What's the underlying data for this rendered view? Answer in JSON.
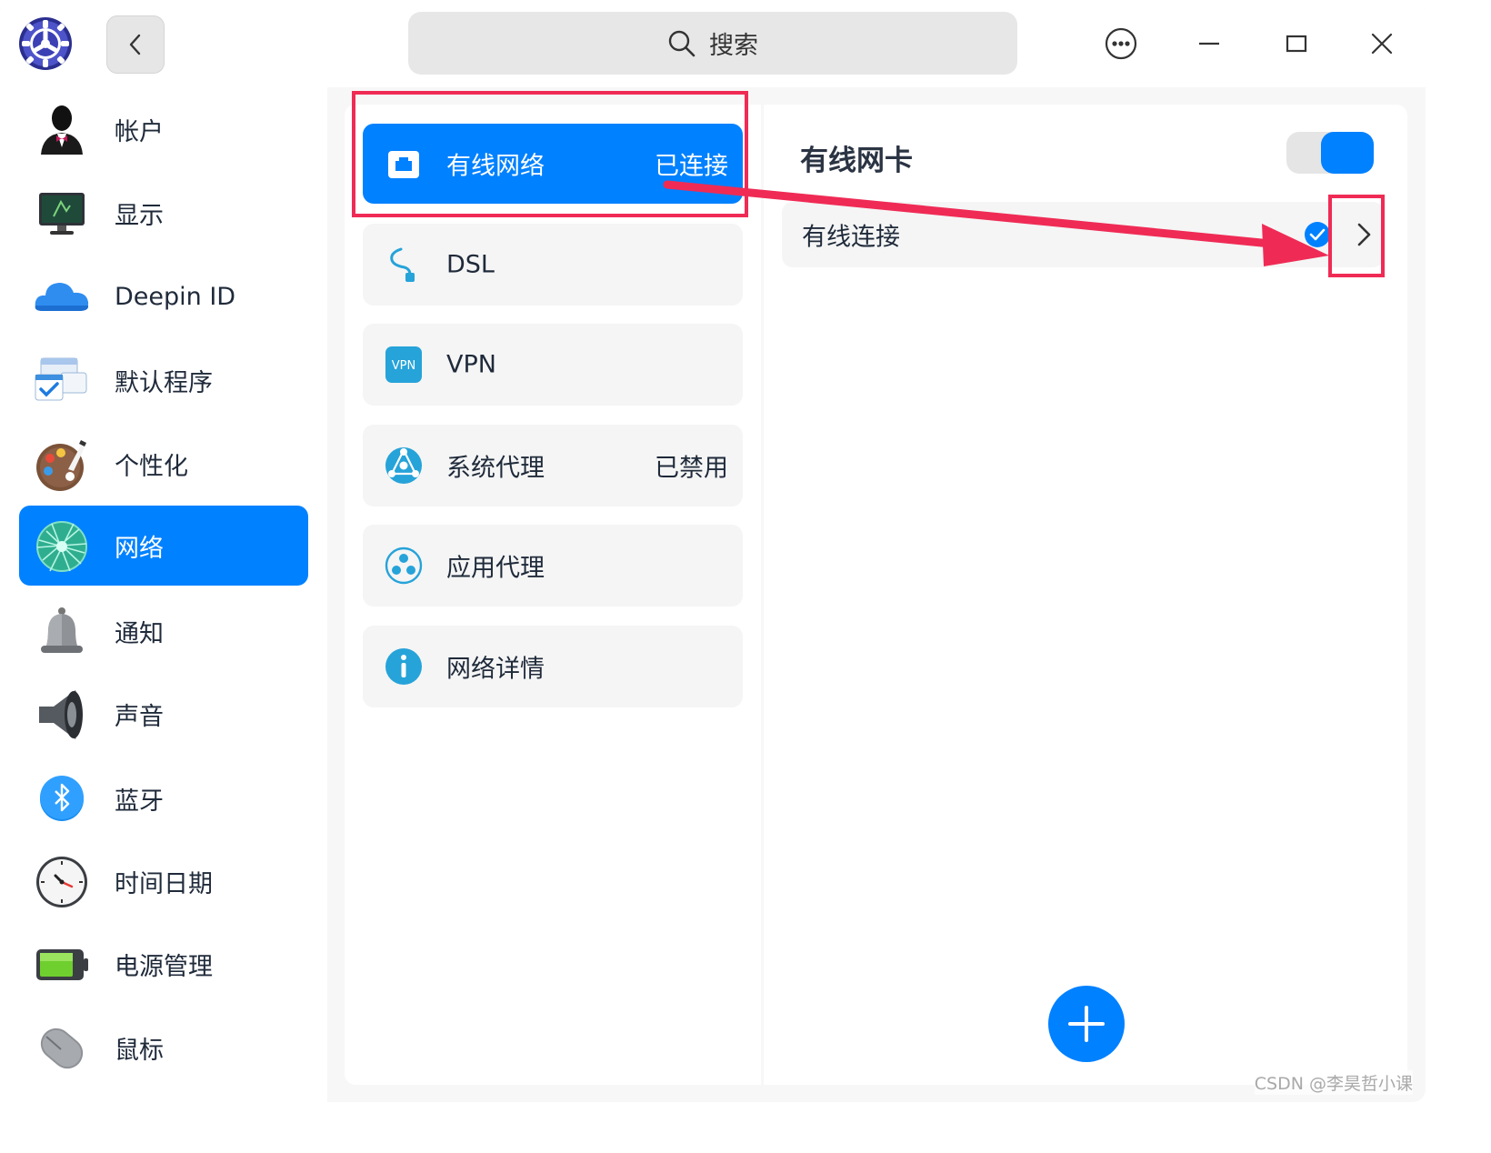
{
  "window": {
    "search_placeholder": "搜索"
  },
  "sidebar": {
    "items": [
      {
        "label": "帐户",
        "icon": "user-account-icon"
      },
      {
        "label": "显示",
        "icon": "display-monitor-icon"
      },
      {
        "label": "Deepin ID",
        "icon": "cloud-icon"
      },
      {
        "label": "默认程序",
        "icon": "default-apps-icon"
      },
      {
        "label": "个性化",
        "icon": "palette-icon"
      },
      {
        "label": "网络",
        "icon": "network-globe-icon",
        "active": true
      },
      {
        "label": "通知",
        "icon": "bell-icon"
      },
      {
        "label": "声音",
        "icon": "speaker-icon"
      },
      {
        "label": "蓝牙",
        "icon": "bluetooth-icon"
      },
      {
        "label": "时间日期",
        "icon": "clock-icon"
      },
      {
        "label": "电源管理",
        "icon": "battery-icon"
      },
      {
        "label": "鼠标",
        "icon": "mouse-icon"
      }
    ]
  },
  "network_menu": {
    "items": [
      {
        "label": "有线网络",
        "status": "已连接",
        "icon": "wired-network-icon",
        "active": true
      },
      {
        "label": "DSL",
        "status": "",
        "icon": "dsl-cable-icon"
      },
      {
        "label": "VPN",
        "status": "",
        "icon": "vpn-icon",
        "icon_text": "VPN"
      },
      {
        "label": "系统代理",
        "status": "已禁用",
        "icon": "system-proxy-icon"
      },
      {
        "label": "应用代理",
        "status": "",
        "icon": "app-proxy-icon"
      },
      {
        "label": "网络详情",
        "status": "",
        "icon": "info-icon"
      }
    ]
  },
  "detail": {
    "card_title": "有线网卡",
    "toggle_on": true,
    "connection_label": "有线连接",
    "connection_selected": true
  },
  "colors": {
    "accent": "#0081ff",
    "annotation": "#ef2b55"
  },
  "watermark": "CSDN @李昊哲小课"
}
